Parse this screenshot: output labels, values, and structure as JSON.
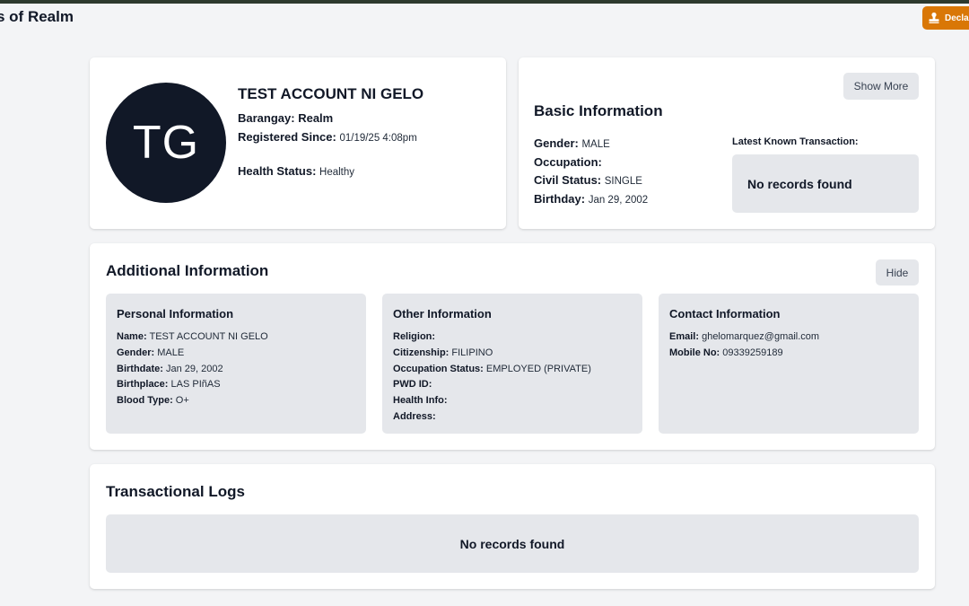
{
  "header": {
    "title": "s of Realm",
    "declare_label": "Decla",
    "declare_icon": "stamp-icon",
    "accent_color": "#d97706"
  },
  "profile": {
    "initials": "TG",
    "name": "TEST ACCOUNT NI GELO",
    "barangay_label": "Barangay:",
    "barangay_value": "Realm",
    "registered_label": "Registered Since:",
    "registered_value": "01/19/25 4:08pm",
    "health_label": "Health Status:",
    "health_value": "Healthy"
  },
  "basic": {
    "show_more_label": "Show More",
    "title": "Basic Information",
    "gender_label": "Gender:",
    "gender_value": "MALE",
    "occupation_label": "Occupation:",
    "occupation_value": "",
    "civil_label": "Civil Status:",
    "civil_value": "SINGLE",
    "birthday_label": "Birthday:",
    "birthday_value": "Jan 29, 2002",
    "latest_label": "Latest Known Transaction:",
    "latest_empty": "No records found"
  },
  "additional": {
    "title": "Additional Information",
    "hide_label": "Hide",
    "panels": [
      {
        "title": "Personal Information",
        "rows": [
          {
            "label": "Name:",
            "value": "TEST ACCOUNT NI GELO"
          },
          {
            "label": "Gender:",
            "value": "MALE"
          },
          {
            "label": "Birthdate:",
            "value": "Jan 29, 2002"
          },
          {
            "label": "Birthplace:",
            "value": "LAS PIñAS"
          },
          {
            "label": "Blood Type:",
            "value": "O+"
          }
        ]
      },
      {
        "title": "Other Information",
        "rows": [
          {
            "label": "Religion:",
            "value": ""
          },
          {
            "label": "Citizenship:",
            "value": "FILIPINO"
          },
          {
            "label": "Occupation Status:",
            "value": "EMPLOYED (PRIVATE)"
          },
          {
            "label": "PWD ID:",
            "value": ""
          },
          {
            "label": "Health Info:",
            "value": ""
          },
          {
            "label": "Address:",
            "value": ""
          }
        ]
      },
      {
        "title": "Contact Information",
        "rows": [
          {
            "label": "Email:",
            "value": "ghelomarquez@gmail.com"
          },
          {
            "label": "Mobile No:",
            "value": "09339259189"
          }
        ]
      }
    ]
  },
  "logs": {
    "title": "Transactional Logs",
    "empty": "No records found"
  }
}
